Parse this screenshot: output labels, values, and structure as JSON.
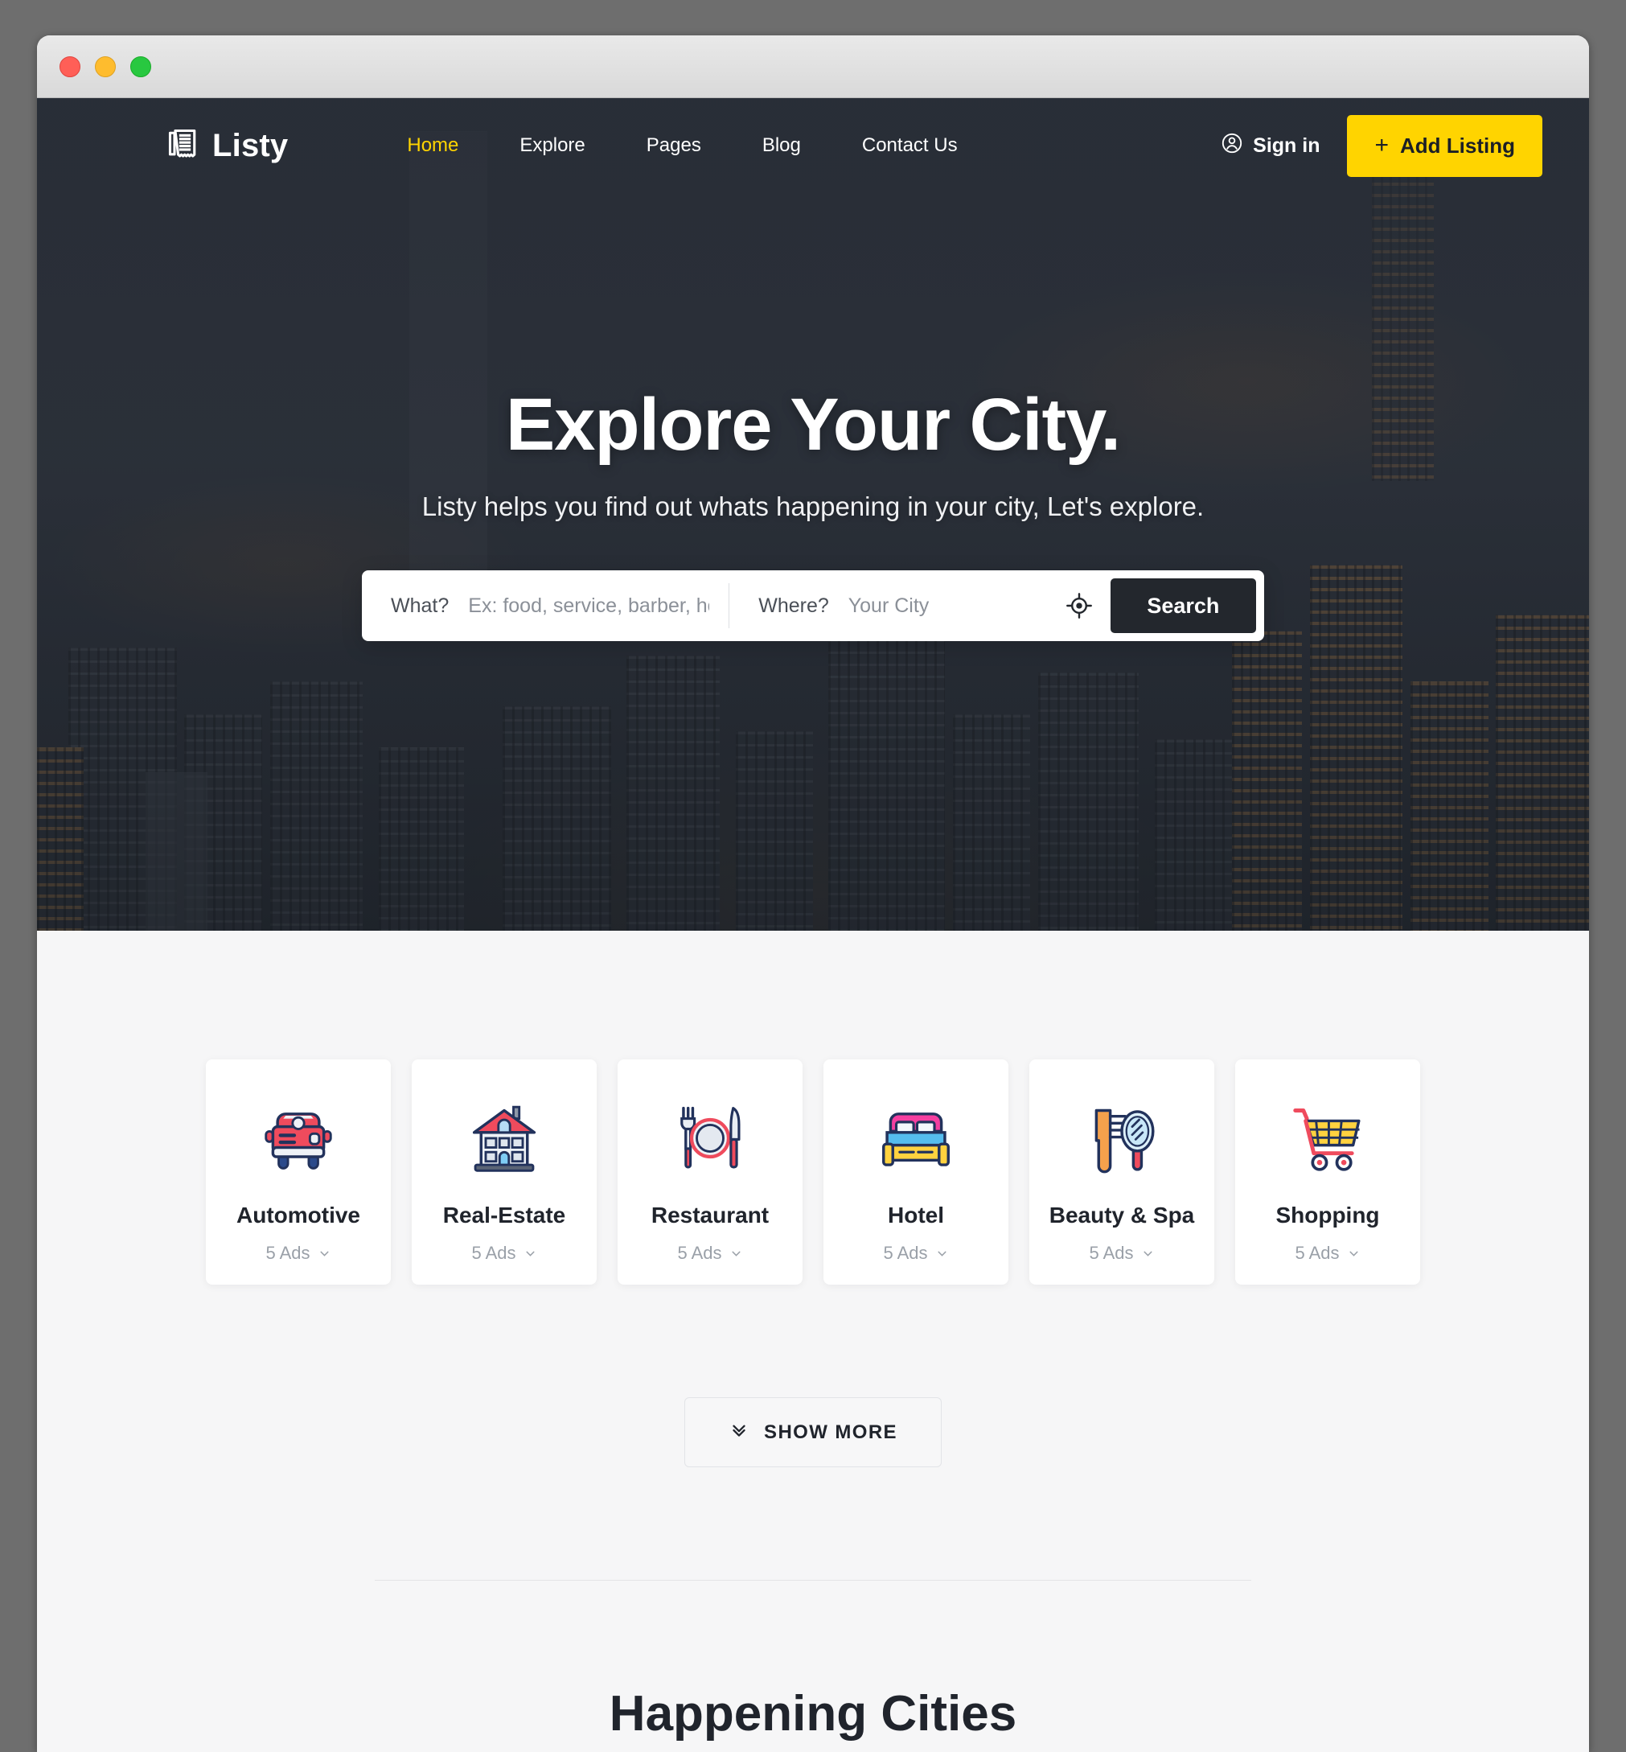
{
  "window": {
    "traffic_lights": [
      "close",
      "minimize",
      "zoom"
    ],
    "colors": {
      "close": "#ff5f57",
      "minimize": "#febc2e",
      "zoom": "#28c840"
    }
  },
  "theme": {
    "accent_yellow": "#ffd400",
    "hero_dark": "#2d333c",
    "search_button_dark": "#23272d",
    "page_background": "#f6f6f7",
    "card_white": "#ffffff"
  },
  "nav": {
    "brand": "Listy",
    "brand_icon": "newspaper-icon",
    "links": [
      {
        "label": "Home",
        "active": true
      },
      {
        "label": "Explore",
        "active": false
      },
      {
        "label": "Pages",
        "active": false
      },
      {
        "label": "Blog",
        "active": false
      },
      {
        "label": "Contact Us",
        "active": false
      }
    ],
    "signin": {
      "label": "Sign in",
      "icon": "user-circle-icon"
    },
    "add_listing": {
      "label": "Add Listing",
      "plus": "+"
    }
  },
  "hero": {
    "title": "Explore Your City.",
    "subtitle": "Listy helps you find out whats happening in your city, Let's explore.",
    "background": "city-night-skyline-photo"
  },
  "search": {
    "what_label": "What?",
    "what_placeholder": "Ex: food, service, barber, hotel",
    "what_value": "",
    "where_label": "Where?",
    "where_placeholder": "Your City",
    "where_value": "",
    "geo_icon": "crosshair-locate-icon",
    "button_label": "Search"
  },
  "categories": [
    {
      "title": "Automotive",
      "ads": "5 Ads",
      "icon": "car-icon"
    },
    {
      "title": "Real-Estate",
      "ads": "5 Ads",
      "icon": "house-icon"
    },
    {
      "title": "Restaurant",
      "ads": "5 Ads",
      "icon": "cutlery-plate-icon"
    },
    {
      "title": "Hotel",
      "ads": "5 Ads",
      "icon": "bed-icon"
    },
    {
      "title": "Beauty & Spa",
      "ads": "5 Ads",
      "icon": "comb-mirror-icon"
    },
    {
      "title": "Shopping",
      "ads": "5 Ads",
      "icon": "shopping-cart-icon"
    }
  ],
  "show_more": {
    "label": "SHOW MORE",
    "icon": "double-chevron-down-icon"
  },
  "next_section": {
    "title": "Happening Cities"
  }
}
